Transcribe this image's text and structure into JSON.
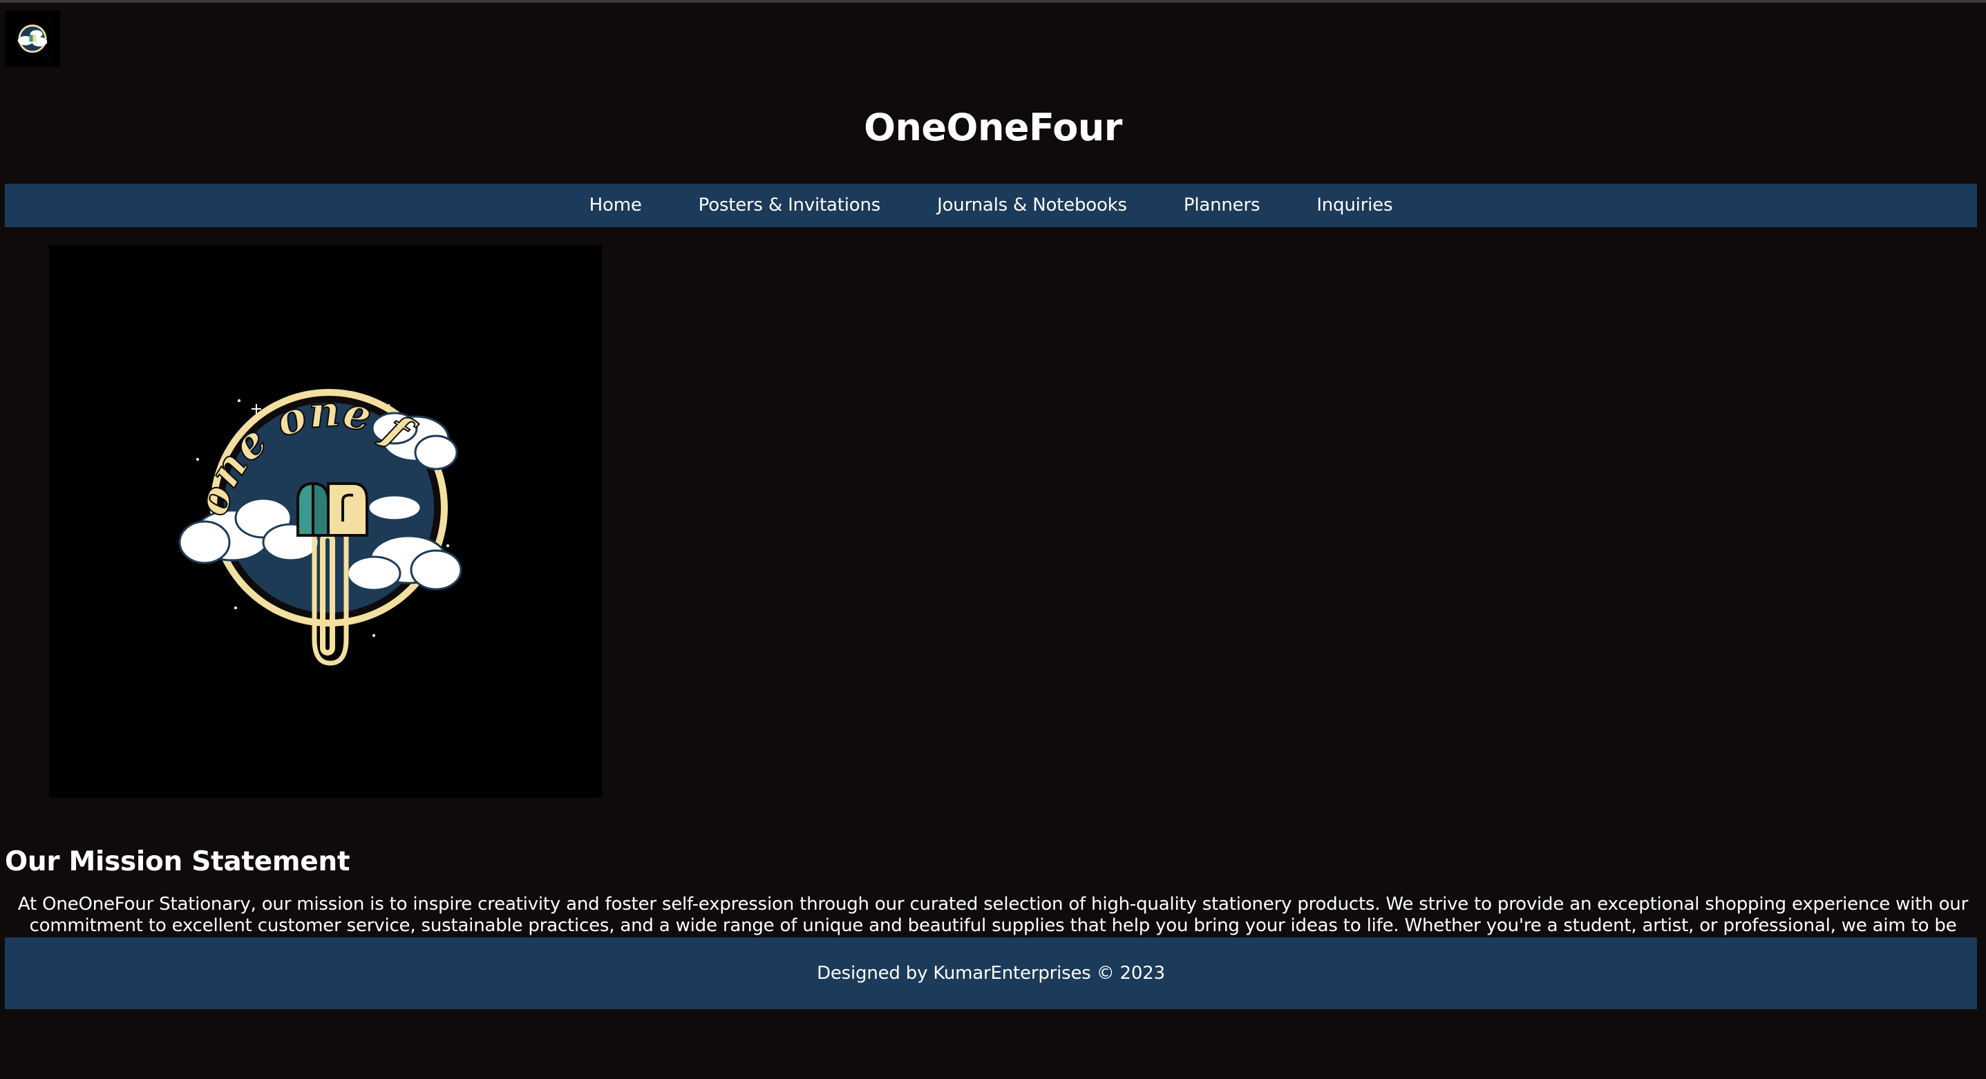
{
  "header": {
    "title": "OneOneFour"
  },
  "nav": {
    "items": [
      {
        "label": "Home"
      },
      {
        "label": "Posters & Invitations"
      },
      {
        "label": "Journals & Notebooks"
      },
      {
        "label": "Planners"
      },
      {
        "label": "Inquiries"
      }
    ]
  },
  "hero": {
    "logo_text": "one one four",
    "icon": "mailbox-globe-logo"
  },
  "mission": {
    "heading": "Our Mission Statement",
    "text": "At OneOneFour Stationary, our mission is to inspire creativity and foster self-expression through our curated selection of high-quality stationery products. We strive to provide an exceptional shopping experience with our commitment to excellent customer service, sustainable practices, and a wide range of unique and beautiful supplies that help you bring your ideas to life. Whether you're a student, artist, or professional, we aim to be your trusted partner in every step of your creative journey."
  },
  "footer": {
    "text": "Designed by KumarEnterprises © 2023"
  },
  "colors": {
    "background": "#0e0b0a",
    "nav_bg": "#1c3a5a",
    "logo_gold": "#f3dfa0",
    "logo_navy": "#1d3b57",
    "logo_teal": "#3a9a8e"
  }
}
